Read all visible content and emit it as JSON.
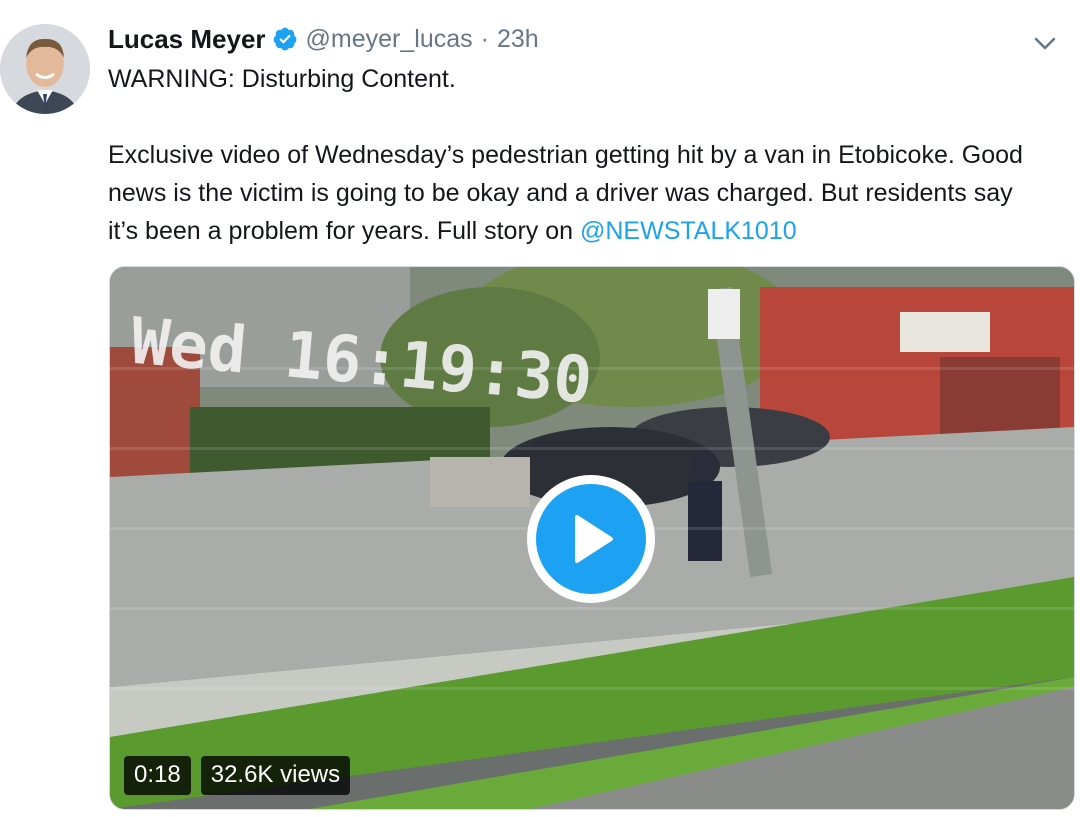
{
  "tweet": {
    "author": {
      "name": "Lucas Meyer",
      "handle": "@meyer_lucas",
      "separator": "·",
      "time": "23h",
      "verified": true
    },
    "text": {
      "warning": "WARNING: Disturbing Content.",
      "body": "Exclusive video of Wednesday’s pedestrian getting hit by a van in Etobicoke. Good news is the victim is going to be okay and a driver was charged. But residents say it’s been a problem for years. Full story on ",
      "mention": "@NEWSTALK1010"
    },
    "media": {
      "duration": "0:18",
      "views": "32.6K views",
      "overlay_timestamp": "Wed 16:19:30"
    }
  },
  "icons": {
    "verified": "verified-badge-icon",
    "menu": "chevron-down-icon",
    "play": "play-icon"
  },
  "colors": {
    "accent": "#1da1f2",
    "text": "#14171a",
    "secondary": "#657786"
  }
}
